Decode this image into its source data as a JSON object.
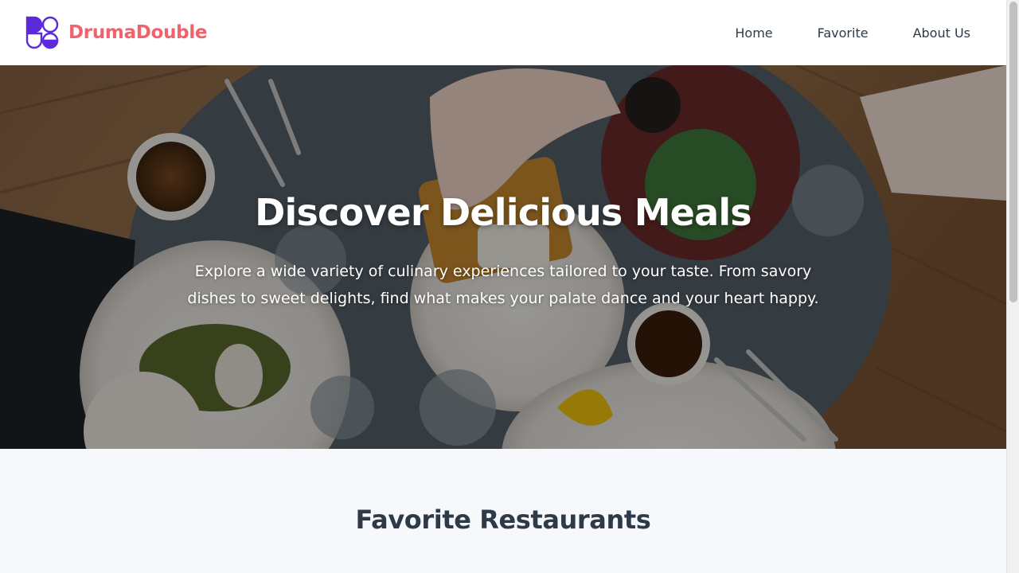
{
  "brand": {
    "name": "DrumaDouble",
    "name_color": "#f0626c",
    "logo_icon": "brand-logo-icon",
    "logo_color": "#5b2bdb"
  },
  "nav": {
    "items": [
      {
        "label": "Home"
      },
      {
        "label": "Favorite"
      },
      {
        "label": "About Us"
      }
    ]
  },
  "hero": {
    "title": "Discover Delicious Meals",
    "subtitle": "Explore a wide variety of culinary experiences tailored to your taste. From savory dishes to sweet delights, find what makes your palate dance and your heart happy.",
    "background": "food-table-photo"
  },
  "section": {
    "title": "Favorite Restaurants"
  },
  "colors": {
    "text_dark": "#2e3a47",
    "page_bg": "#f7f8fc"
  }
}
